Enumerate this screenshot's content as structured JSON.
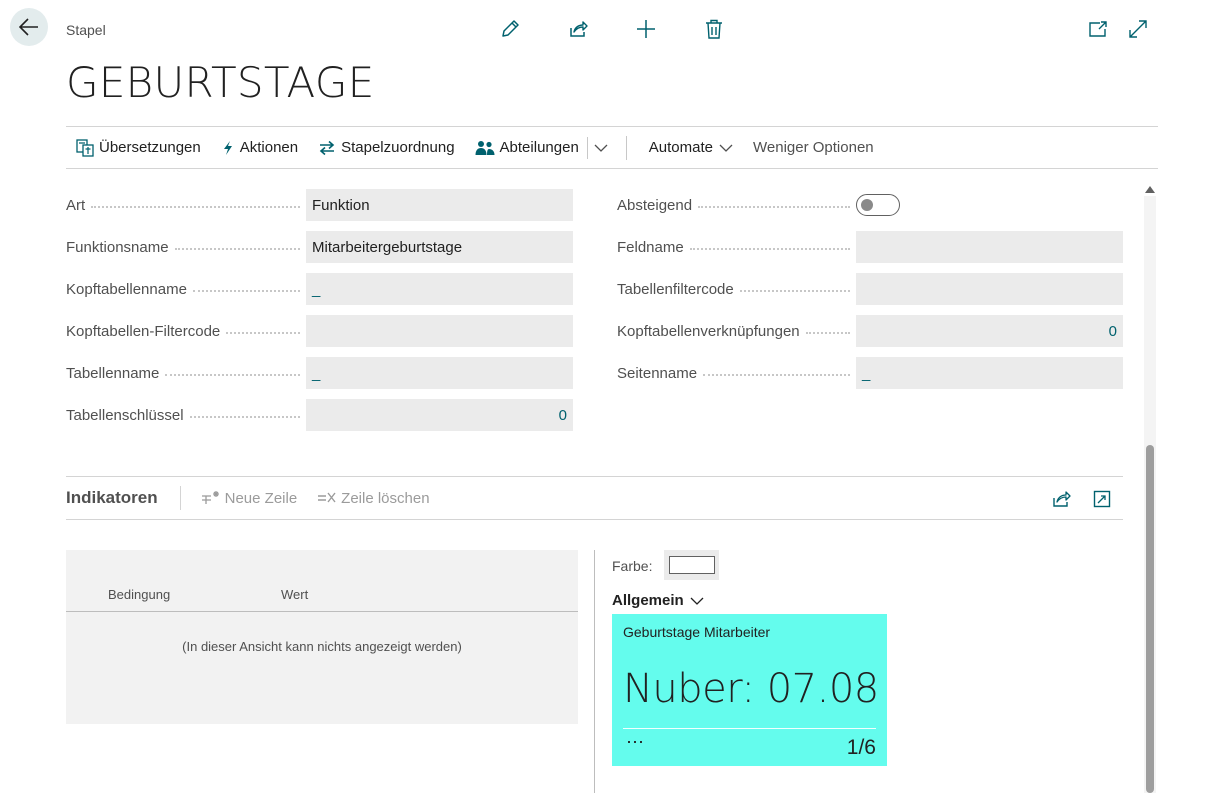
{
  "header": {
    "breadcrumb": "Stapel",
    "title": "GEBURTSTAGE"
  },
  "top_actions": [
    "pencil-icon",
    "share-icon",
    "plus-icon",
    "trash-icon"
  ],
  "window_actions": [
    "open-new-window-icon",
    "expand-icon"
  ],
  "action_bar": {
    "uebersetzungen": "Übersetzungen",
    "aktionen": "Aktionen",
    "stapelzuordnung": "Stapelzuordnung",
    "abteilungen": "Abteilungen",
    "automate": "Automate",
    "weniger_optionen": "Weniger Optionen"
  },
  "fields_left": [
    {
      "label": "Art",
      "value": "Funktion"
    },
    {
      "label": "Funktionsname",
      "value": "Mitarbeitergeburtstage"
    },
    {
      "label": "Kopftabellenname",
      "value": "_"
    },
    {
      "label": "Kopftabellen-Filtercode",
      "value": ""
    },
    {
      "label": "Tabellenname",
      "value": "_"
    },
    {
      "label": "Tabellenschlüssel",
      "value": "0"
    }
  ],
  "fields_right": [
    {
      "label": "Absteigend",
      "value": "off"
    },
    {
      "label": "Feldname",
      "value": ""
    },
    {
      "label": "Tabellenfiltercode",
      "value": ""
    },
    {
      "label": "Kopftabellenverknüpfungen",
      "value": "0"
    },
    {
      "label": "Seitenname",
      "value": "_"
    }
  ],
  "indicators": {
    "title": "Indikatoren",
    "new_line": "Neue Zeile",
    "delete_line": "Zeile löschen",
    "columns": [
      "Bedingung",
      "Wert"
    ],
    "empty_text": "(In dieser Ansicht kann nichts angezeigt werden)"
  },
  "details": {
    "farbe_label": "Farbe:",
    "farbe_value": "#ffffff",
    "allgemein": "Allgemein",
    "tile": {
      "title": "Geburtstage Mitarbeiter",
      "value": "Nuber: 07.08",
      "more": "⋯",
      "page": "1/6",
      "color": "#64fced"
    }
  },
  "colors": {
    "accent": "#00616e",
    "tile": "#64fced"
  }
}
